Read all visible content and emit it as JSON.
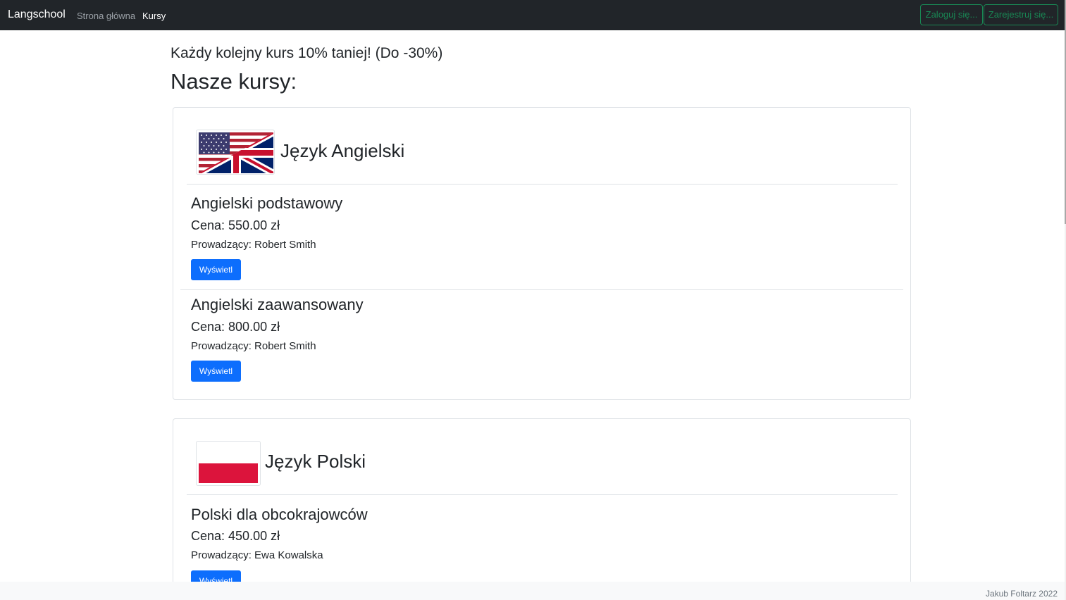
{
  "navbar": {
    "brand": "Langschool",
    "links": [
      {
        "label": "Strona główna"
      },
      {
        "label": "Kursy"
      }
    ],
    "login_label": "Zaloguj się...",
    "register_label": "Zarejestruj się...",
    "accent_color": "#198754"
  },
  "main": {
    "promo": "Każdy kolejny kurs 10% taniej! (Do -30%)",
    "title": "Nasze kursy:",
    "languages": [
      {
        "name": "Język Angielski",
        "flag_icon": "us-uk-flag-icon",
        "courses": [
          {
            "title": "Angielski podstawowy",
            "price": "Cena: 550.00 zł",
            "teacher": "Prowadzący: Robert Smith",
            "button": "Wyświetl"
          },
          {
            "title": "Angielski zaawansowany",
            "price": "Cena: 800.00 zł",
            "teacher": "Prowadzący: Robert Smith",
            "button": "Wyświetl"
          }
        ]
      },
      {
        "name": "Język Polski",
        "flag_icon": "poland-flag-icon",
        "courses": [
          {
            "title": "Polski dla obcokrajowców",
            "price": "Cena: 450.00 zł",
            "teacher": "Prowadzący: Ewa Kowalska",
            "button": "Wyświetl"
          }
        ]
      }
    ],
    "button_color": "#0d6efd"
  },
  "footer": {
    "text": "Jakub Foltarz 2022"
  }
}
